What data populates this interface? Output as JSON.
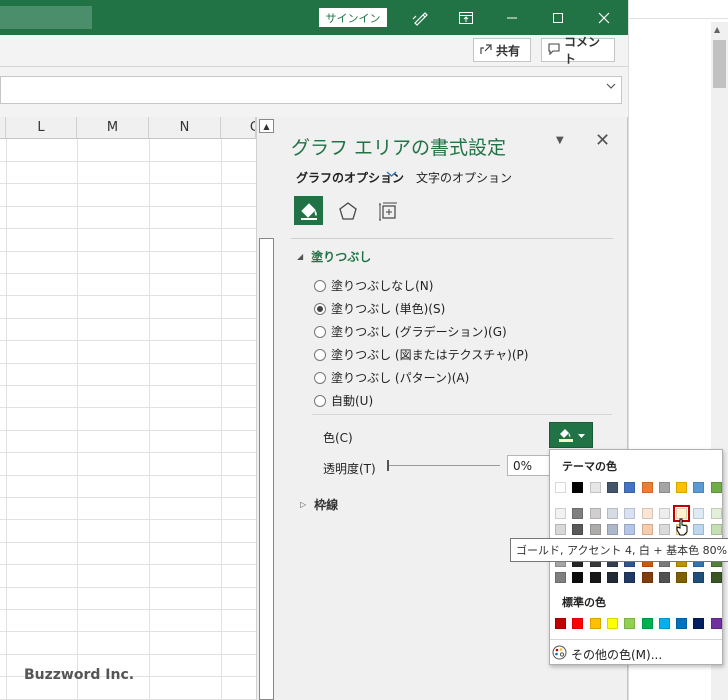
{
  "titlebar": {
    "signin_label": "サインイン",
    "accent": "#217346"
  },
  "ribbon": {
    "share_label": "共有",
    "comment_label": "コメント"
  },
  "sheet": {
    "columns": [
      "L",
      "M",
      "N",
      "C"
    ],
    "watermark": "Buzzword Inc."
  },
  "pane": {
    "title": "グラフ エリアの書式設定",
    "tabs": [
      {
        "label": "グラフのオプション",
        "active": true
      },
      {
        "label": "文字のオプション",
        "active": false
      }
    ],
    "category_icons": [
      "fill-line-icon",
      "effects-pentagon-icon",
      "size-properties-icon"
    ],
    "fill_section": {
      "title": "塗りつぶし",
      "options": [
        {
          "label": "塗りつぶしなし(N)",
          "selected": false
        },
        {
          "label": "塗りつぶし (単色)(S)",
          "selected": true
        },
        {
          "label": "塗りつぶし (グラデーション)(G)",
          "selected": false
        },
        {
          "label": "塗りつぶし (図またはテクスチャ)(P)",
          "selected": false
        },
        {
          "label": "塗りつぶし (パターン)(A)",
          "selected": false
        },
        {
          "label": "自動(U)",
          "selected": false
        }
      ],
      "color_label": "色(C)",
      "transparency_label": "透明度(T)",
      "transparency_value": "0%"
    },
    "border_section": {
      "title": "枠線"
    }
  },
  "color_popup": {
    "theme_title": "テーマの色",
    "theme_colors": [
      "#ffffff",
      "#000000",
      "#e7e6e6",
      "#44546a",
      "#4472c4",
      "#ed7d31",
      "#a5a5a5",
      "#ffc000",
      "#5b9bd5",
      "#70ad47"
    ],
    "tints": [
      [
        "#f2f2f2",
        "#7f7f7f",
        "#d0cece",
        "#d6dce4",
        "#d9e2f3",
        "#fbe5d5",
        "#ededed",
        "#fff2cc",
        "#deebf6",
        "#e2efd9"
      ],
      [
        "#d8d8d8",
        "#595959",
        "#aeabab",
        "#adb9ca",
        "#b4c6e7",
        "#f7cbac",
        "#dbdbdb",
        "#fee599",
        "#bdd7ee",
        "#c5e0b3"
      ],
      [
        "#bfbfbf",
        "#3f3f3f",
        "#757070",
        "#8496b0",
        "#8eaadb",
        "#f4b183",
        "#c9c9c9",
        "#ffd965",
        "#9cc3e5",
        "#a8d08d"
      ],
      [
        "#a5a5a5",
        "#262626",
        "#3a3838",
        "#323f4f",
        "#2f5496",
        "#c55a11",
        "#7b7b7b",
        "#bf9000",
        "#2e75b5",
        "#538135"
      ],
      [
        "#7f7f7f",
        "#0c0c0c",
        "#171616",
        "#222a35",
        "#1f3864",
        "#833c0b",
        "#525252",
        "#7f6000",
        "#1e4e79",
        "#375623"
      ]
    ],
    "standard_title": "標準の色",
    "standard_colors": [
      "#c00000",
      "#ff0000",
      "#ffc000",
      "#ffff00",
      "#92d050",
      "#00b050",
      "#00b0f0",
      "#0070c0",
      "#002060",
      "#7030a0"
    ],
    "more_colors_label": "その他の色(M)...",
    "tooltip": "ゴールド, アクセント 4, 白 + 基本色 80%"
  }
}
